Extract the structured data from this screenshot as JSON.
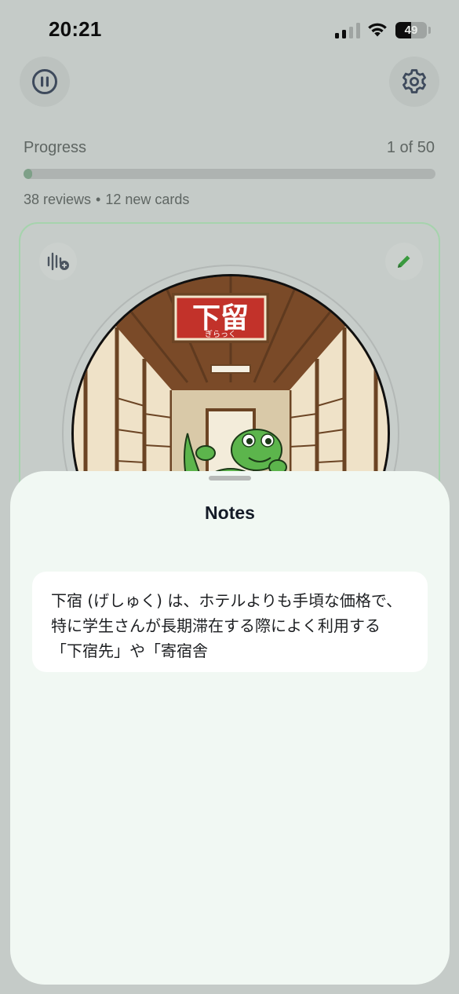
{
  "status_bar": {
    "time": "20:21",
    "battery_level": "49",
    "signal_bars_active": 2,
    "signal_bars_total": 4
  },
  "top_bar": {
    "pause_icon": "pause-icon",
    "settings_icon": "gear-icon"
  },
  "progress": {
    "label": "Progress",
    "count": "1 of 50",
    "fraction": 0.02,
    "reviews": "38 reviews",
    "separator": "•",
    "new_cards": "12 new cards"
  },
  "card": {
    "audio_icon": "waveform-plus-icon",
    "edit_icon": "pencil-icon",
    "accent_color": "#a6d3ad",
    "illustration": {
      "sign_kanji": "下留",
      "sign_furigana": "ぎらっく"
    }
  },
  "notes_sheet": {
    "title": "Notes",
    "note": "下宿 (げしゅく) は、ホテルよりも手頃な価格で、特に学生さんが長期滞在する際によく利用する「下宿先」や「寄宿舎"
  },
  "colors": {
    "sign_red": "#c2322a",
    "gecko_green": "#5cb54c",
    "pencil_green": "#3a9a3f"
  }
}
